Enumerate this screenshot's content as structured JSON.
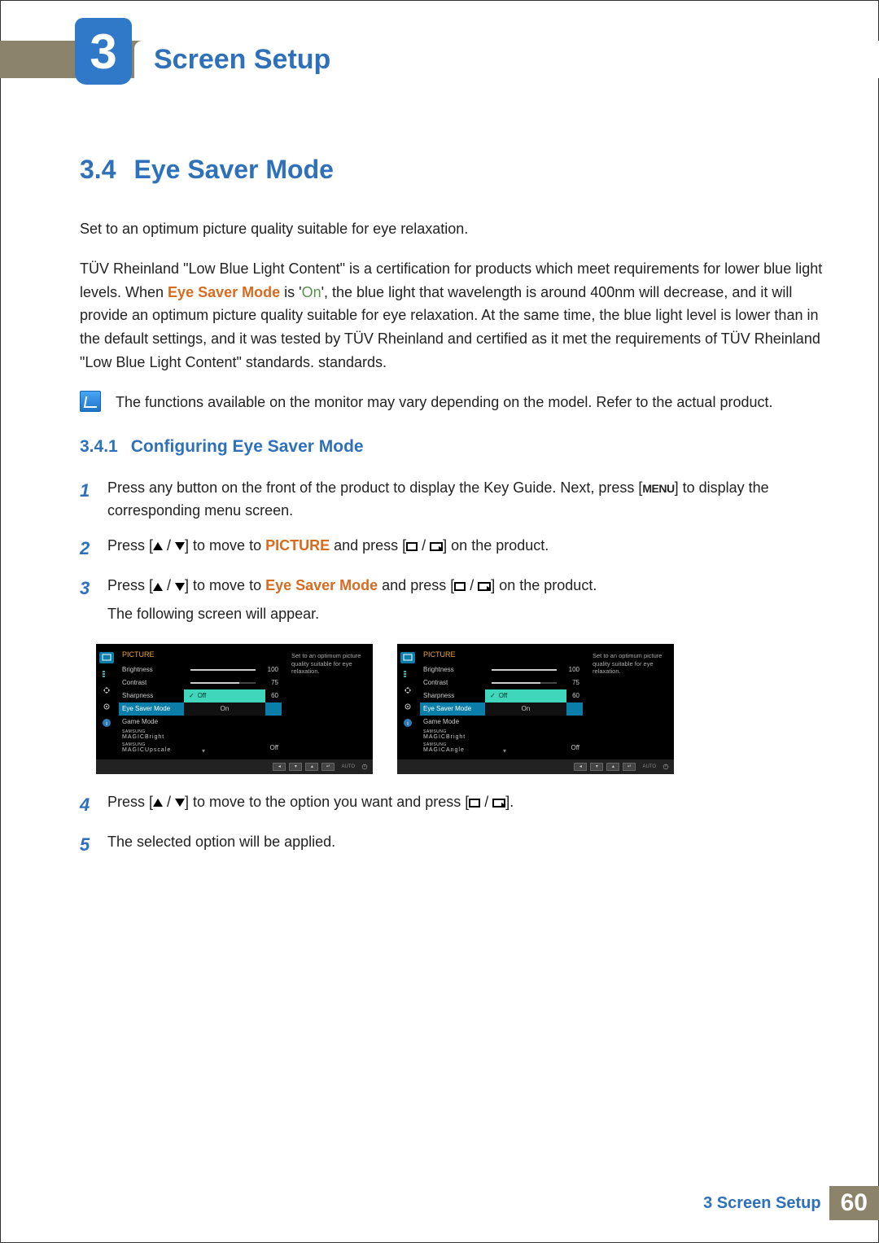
{
  "chapter": {
    "number": "3",
    "title": "Screen Setup"
  },
  "section": {
    "number": "3.4",
    "title": "Eye Saver Mode"
  },
  "paragraphs": {
    "p1": "Set to an optimum picture quality suitable for eye relaxation.",
    "p2a": "TÜV Rheinland \"Low Blue Light Content\" is a certification for products which meet requirements for lower blue light levels. When ",
    "p2b": "Eye Saver Mode",
    "p2c": " is '",
    "p2d": "On",
    "p2e": "', the blue light that wavelength is around 400nm will decrease, and it will provide an optimum picture quality suitable for eye relaxation. At the same time, the blue light level is lower than in the default settings, and it was tested by TÜV Rheinland and certified as it met the requirements of TÜV Rheinland \"Low Blue Light Content\" standards. standards.",
    "note": "The functions available on the monitor may vary depending on the model. Refer to the actual product."
  },
  "subsection": {
    "number": "3.4.1",
    "title": "Configuring Eye Saver Mode"
  },
  "steps": {
    "s1": {
      "num": "1",
      "a": "Press any button on the front of the product to display the Key Guide. Next, press [",
      "menu": "MENU",
      "b": "] to display the corresponding menu screen."
    },
    "s2": {
      "num": "2",
      "a": "Press [",
      "b": "] to move to ",
      "target": "PICTURE",
      "c": " and press [",
      "d": "] on the product."
    },
    "s3": {
      "num": "3",
      "a": "Press [",
      "b": "] to move to ",
      "target": "Eye Saver Mode",
      "c": " and press [",
      "d": "] on the product.",
      "e": "The following screen will appear."
    },
    "s4": {
      "num": "4",
      "a": "Press [",
      "b": "] to move to the option you want and press [",
      "c": "]."
    },
    "s5": {
      "num": "5",
      "a": "The selected option will be applied."
    }
  },
  "osd": {
    "header": "PICTURE",
    "tip": "Set to an optimum picture quality suitable for eye relaxation.",
    "rows": {
      "brightness": {
        "label": "Brightness",
        "value": "100",
        "fill": 100
      },
      "contrast": {
        "label": "Contrast",
        "value": "75",
        "fill": 75
      },
      "sharpness": {
        "label": "Sharpness",
        "value": "60",
        "fill": 60
      },
      "eyesaver": {
        "label": "Eye Saver Mode"
      },
      "gamemode": {
        "label": "Game Mode"
      },
      "magic1a": {
        "brand": "SAMSUNG",
        "line": "MAGIC",
        "suffix": "Bright"
      },
      "magic1b": {
        "brand": "SAMSUNG",
        "line": "MAGIC",
        "suffix": "Upscale",
        "value": "Off"
      },
      "magic2b": {
        "brand": "SAMSUNG",
        "line": "MAGIC",
        "suffix": "Angle",
        "value": "Off"
      }
    },
    "submenu": {
      "off": "Off",
      "on": "On"
    },
    "auto": "AUTO"
  },
  "footer": {
    "label": "3 Screen Setup",
    "page": "60"
  }
}
